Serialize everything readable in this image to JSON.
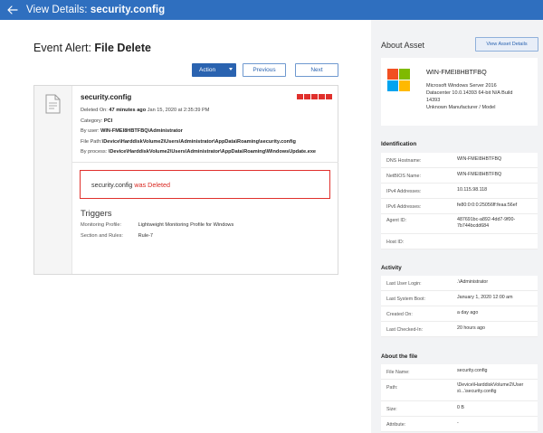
{
  "topbar": {
    "prefix": "View Details:",
    "file": "security.config"
  },
  "event": {
    "title_prefix": "Event Alert:",
    "title_bold": "File Delete"
  },
  "toolbar": {
    "action_label": "Action",
    "previous_label": "Previous",
    "next_label": "Next"
  },
  "card": {
    "file_name": "security.config",
    "deleted_on_label": "Deleted On:",
    "deleted_on_rel": "47 minutes ago",
    "deleted_on_abs": "Jan 15, 2020 at 2:35:39 PM",
    "category_label": "Category:",
    "category_value": "PCI",
    "user_label": "By user:",
    "user_value": "WIN-FMEI8HBTFBQ\\Administrator",
    "path_label": "File Path:",
    "path_value": "\\Device\\HarddiskVolume2\\Users\\Administrator\\AppData\\Roaming\\security.config",
    "process_label": "By process:",
    "process_value": "\\Device\\HarddiskVolume2\\Users\\Administrator\\AppData\\Roaming\\WindowsUpdate.exe",
    "severity_color": "#e0302c",
    "alert_text": "security.config",
    "alert_status": "was Deleted",
    "triggers_title": "Triggers",
    "monitoring_profile_label": "Monitoring Profile:",
    "monitoring_profile_value": "Lightweight Monitoring Profile for Windows",
    "section_rules_label": "Section and Rules:",
    "section_rules_value": "Rule-7"
  },
  "asset": {
    "title": "About Asset",
    "view_button": "View Asset Details",
    "name": "WIN-FMEI8HBTFBQ",
    "os_line1": "Microsoft Windows Server 2016",
    "os_line2": "Datacenter 10.0.14393 64-bit N/A Build",
    "os_line3": "14393",
    "manufacturer": "Unknown Manufacturer / Model"
  },
  "identification": {
    "title": "Identification",
    "rows": [
      {
        "label": "DNS Hostname:",
        "value": "WIN-FMEI8HBTFBQ"
      },
      {
        "label": "NetBIOS Name:",
        "value": "WIN-FMEI8HBTFBQ"
      },
      {
        "label": "IPv4 Addresses:",
        "value": "10.115.98.118"
      },
      {
        "label": "IPv6 Addresses:",
        "value": "fe80:0:0:0:25056ff:feaa:56ef"
      },
      {
        "label": "Agent ID:",
        "value": "487691bc-a892-4dd7-9f00-7b744bcdd684"
      },
      {
        "label": "Host ID:",
        "value": ""
      }
    ]
  },
  "activity": {
    "title": "Activity",
    "rows": [
      {
        "label": "Last User Login:",
        "value": ".\\Administrator"
      },
      {
        "label": "Last System Boot:",
        "value": "January 1, 2020 12:00 am"
      },
      {
        "label": "Created On:",
        "value": "a day ago"
      },
      {
        "label": "Last Checked-In:",
        "value": "20 hours ago"
      }
    ]
  },
  "about_file": {
    "title": "About the file",
    "rows": [
      {
        "label": "File Name:",
        "value": "security.config"
      },
      {
        "label": "Path:",
        "value": "\\Device\\HarddiskVolume2\\User s\\...\\security.config"
      },
      {
        "label": "Size:",
        "value": "0 B"
      },
      {
        "label": "Attribute:",
        "value": "-"
      }
    ]
  }
}
